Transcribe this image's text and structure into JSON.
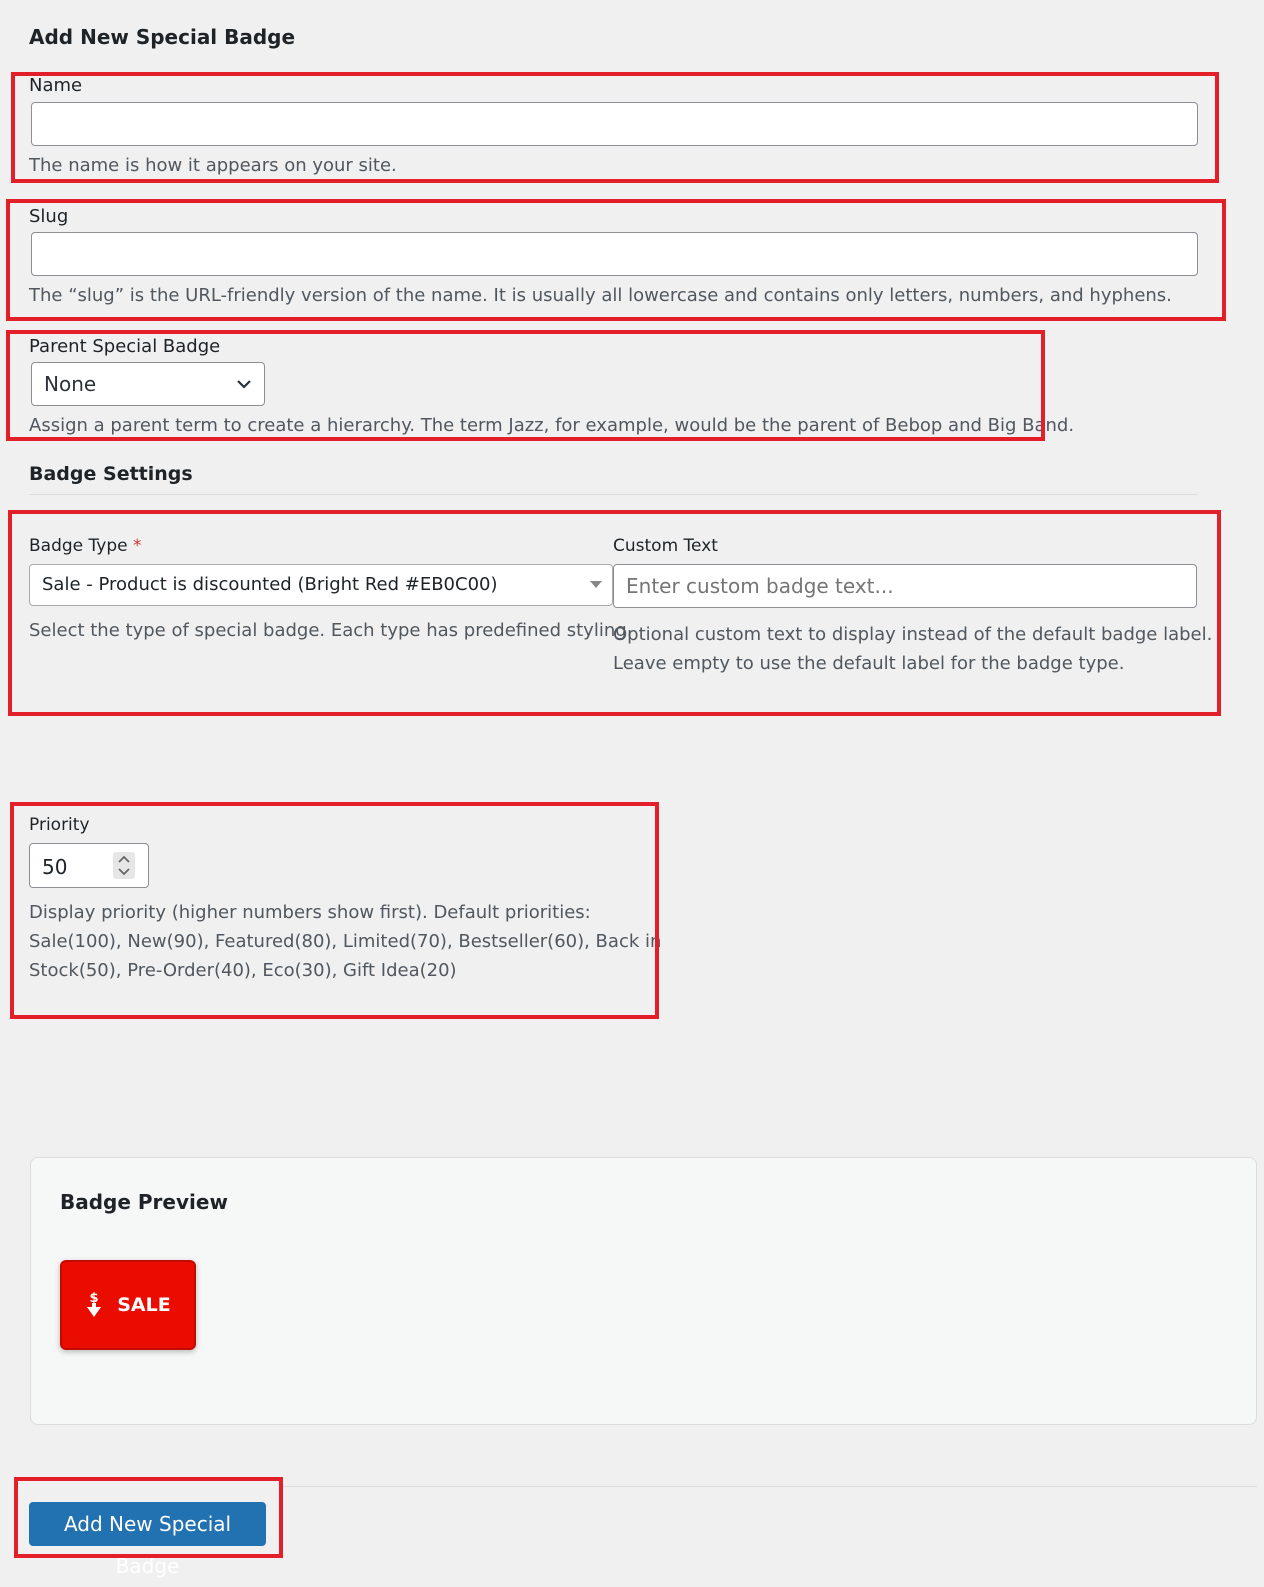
{
  "page_title": "Add New Special Badge",
  "name_field": {
    "label": "Name",
    "value": "",
    "description": "The name is how it appears on your site."
  },
  "slug_field": {
    "label": "Slug",
    "value": "",
    "description": "The “slug” is the URL-friendly version of the name. It is usually all lowercase and contains only letters, numbers, and hyphens."
  },
  "parent_field": {
    "label": "Parent Special Badge",
    "selected": "None",
    "description": "Assign a parent term to create a hierarchy. The term Jazz, for example, would be the parent of Bebop and Big Band."
  },
  "badge_settings": {
    "heading": "Badge Settings",
    "badge_type": {
      "label": "Badge Type",
      "required_mark": "*",
      "selected": "Sale - Product is discounted (Bright Red #EB0C00)",
      "description": "Select the type of special badge. Each type has predefined styling."
    },
    "custom_text": {
      "label": "Custom Text",
      "placeholder": "Enter custom badge text...",
      "value": "",
      "description_line1": "Optional custom text to display instead of the default badge label.",
      "description_line2": "Leave empty to use the default label for the badge type."
    },
    "priority": {
      "label": "Priority",
      "value": "50",
      "description_line1": "Display priority (higher numbers show first). Default priorities:",
      "description_line2": "Sale(100), New(90), Featured(80), Limited(70), Bestseller(60), Back in",
      "description_line3": "Stock(50), Pre-Order(40), Eco(30), Gift Idea(20)"
    }
  },
  "preview": {
    "heading": "Badge Preview",
    "badge_label": "SALE",
    "badge_color": "#EB0C00",
    "badge_icon": "dollar-down-arrow-icon"
  },
  "submit_label": "Add New Special Badge",
  "colors": {
    "highlight": "#e3202a",
    "primary_button": "#2271b1",
    "page_bg": "#f0f0f1"
  }
}
